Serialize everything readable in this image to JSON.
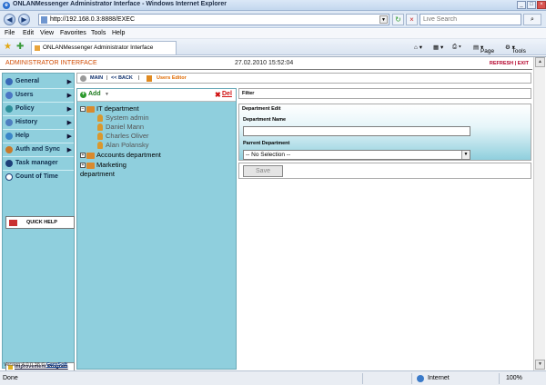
{
  "browser": {
    "window_title": "ONLANMessenger Administrator Interface - Windows Internet Explorer",
    "url": "http://192.168.0.3:8888/EXEC",
    "search_placeholder": "Live Search",
    "menu": [
      "File",
      "Edit",
      "View",
      "Favorites",
      "Tools",
      "Help"
    ],
    "tab_title": "ONLANMessenger Administrator Interface",
    "cmd": {
      "page": "Page",
      "tools": "Tools"
    },
    "status": "Done",
    "zone": "Internet",
    "zoom": "100%"
  },
  "app": {
    "title": "ADMINISTRATOR INTERFACE",
    "datetime": "27.02.2010 15:52:04",
    "refresh": "REFRESH",
    "exit": "EXIT",
    "link_sep": "|"
  },
  "nav": {
    "items": [
      {
        "label": "General",
        "arrow": "▶"
      },
      {
        "label": "Users",
        "arrow": "▶"
      },
      {
        "label": "Policy",
        "arrow": "▶"
      },
      {
        "label": "History",
        "arrow": "▶"
      },
      {
        "label": "Help",
        "arrow": "▶"
      },
      {
        "label": "Auth and Sync",
        "arrow": "▶"
      },
      {
        "label": "Task manager",
        "arrow": ""
      },
      {
        "label": "Count of Time",
        "arrow": ""
      }
    ],
    "quick_help": "QUICK HELP",
    "improvement": "Improvement Program",
    "version": "Version:4.0.0.38 ©",
    "vendor": "CarpSoft"
  },
  "breadcrumb": {
    "main": "MAIN",
    "sep1": "|",
    "back": "<< BACK",
    "sep2": "|",
    "current": "Users Editor"
  },
  "tree": {
    "add": "Add",
    "del": "Del",
    "nodes": {
      "it": "IT department",
      "u1": "System admin",
      "u2": "Daniel Mann",
      "u3": "Charles Oliver",
      "u4": "Alan Polansky",
      "acc": "Accounts department",
      "mkt1": "Marketing",
      "mkt2": "department"
    }
  },
  "filter": {
    "label": "Filter"
  },
  "department_edit": {
    "title": "Department Edit",
    "name_label": "Department Name",
    "name_value": "",
    "parent_label": "Parrent Department",
    "parent_value": "-- No Selection --",
    "save": "Save"
  }
}
